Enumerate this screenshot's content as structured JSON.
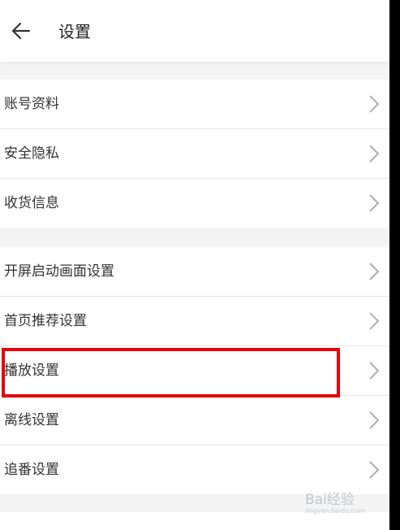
{
  "header": {
    "back_icon": "arrow-left-icon",
    "title": "设置"
  },
  "groups": [
    {
      "items": [
        {
          "label": "账号资料"
        },
        {
          "label": "安全隐私"
        },
        {
          "label": "收货信息"
        }
      ]
    },
    {
      "items": [
        {
          "label": "开屏启动画面设置"
        },
        {
          "label": "首页推荐设置"
        },
        {
          "label": "播放设置"
        },
        {
          "label": "离线设置"
        },
        {
          "label": "追番设置"
        }
      ]
    }
  ],
  "chevron_icon": "chevron-right-icon",
  "highlight": {
    "target": "播放设置",
    "color": "#e8000a"
  },
  "watermark": {
    "main": "Bai经验",
    "sub": "jingyan.baidu.com"
  }
}
